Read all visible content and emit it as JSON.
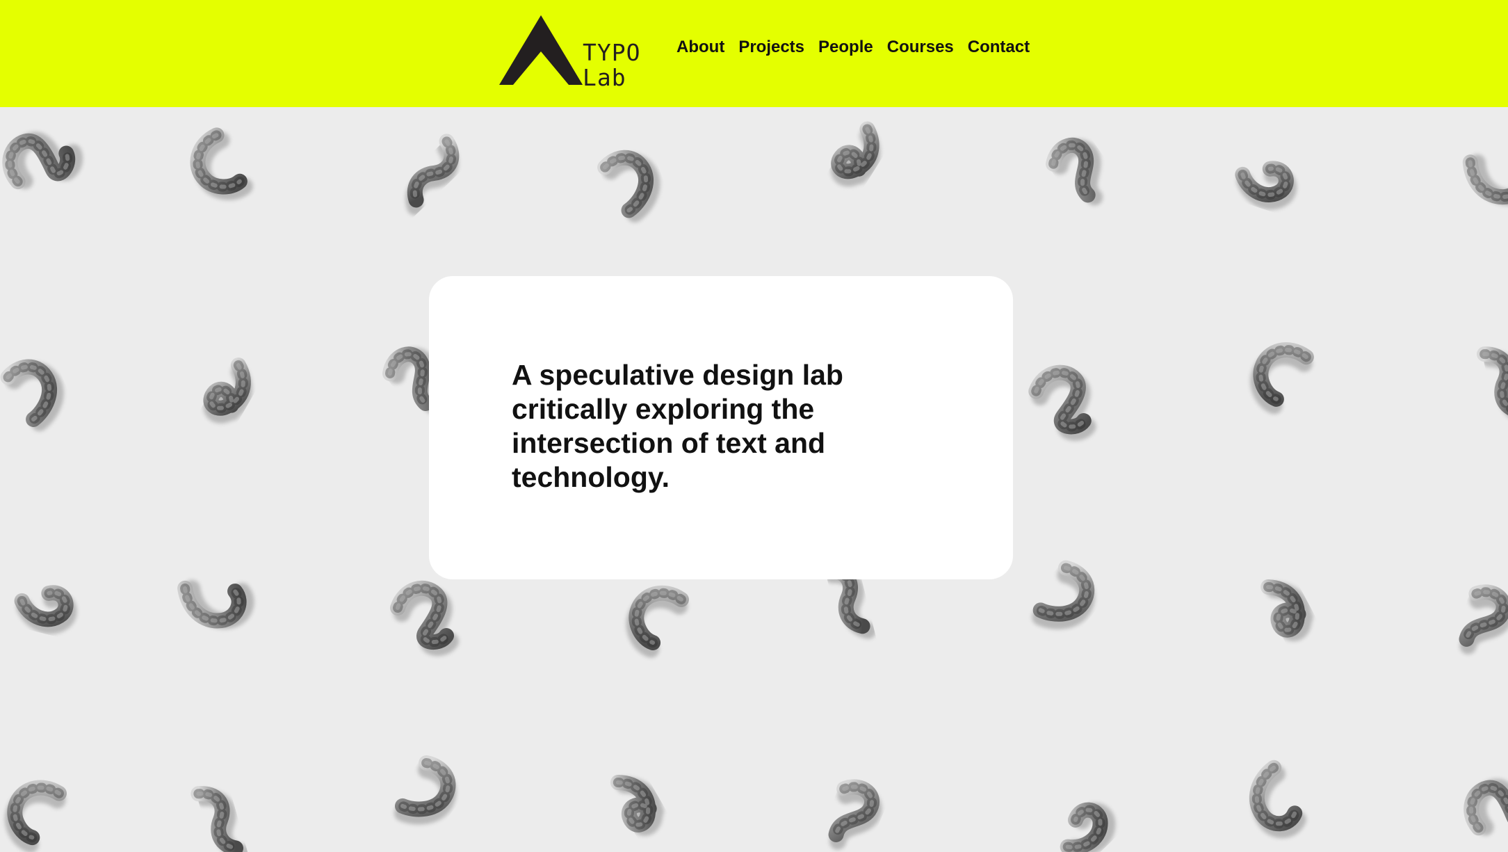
{
  "header": {
    "background": "#e4ff00",
    "logo": {
      "line1": "TYPO",
      "line2": "Lab",
      "icon": "triangle-a-logo-icon"
    },
    "nav": [
      {
        "label": "About"
      },
      {
        "label": "Projects"
      },
      {
        "label": "People"
      },
      {
        "label": "Courses"
      },
      {
        "label": "Contact"
      }
    ]
  },
  "hero": {
    "image": "metal-glyph-sculptures-photo",
    "card": {
      "headline": "A speculative design lab critically exploring the intersection of text and technology."
    }
  }
}
